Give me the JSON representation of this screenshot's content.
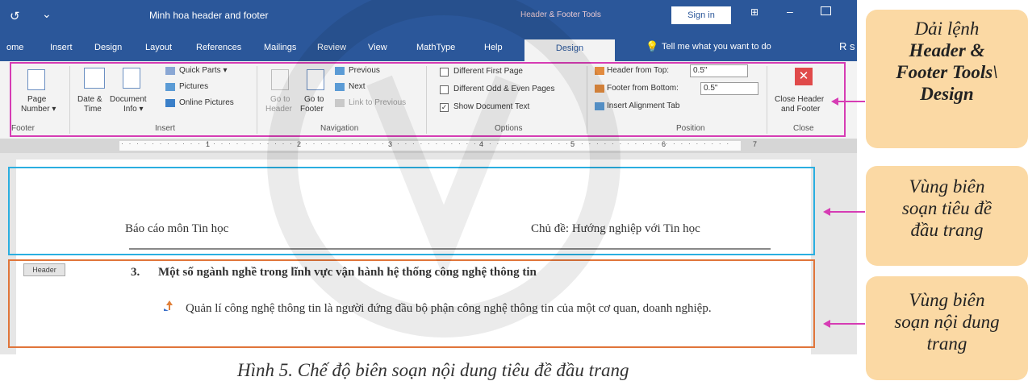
{
  "titlebar": {
    "qat_icon": "↺",
    "qat_more": "⌄",
    "document_title": "Minh hoa header and footer",
    "context_title": "Header & Footer Tools",
    "signin_label": "Sign in",
    "ribbon_display_icon": "ribbon-display-icon",
    "minimize_icon": "–",
    "maximize_icon": "maximize-icon"
  },
  "tabs": [
    {
      "label": "ome"
    },
    {
      "label": "Insert"
    },
    {
      "label": "Design"
    },
    {
      "label": "Layout"
    },
    {
      "label": "References"
    },
    {
      "label": "Mailings"
    },
    {
      "label": "Review"
    },
    {
      "label": "View"
    },
    {
      "label": "MathType"
    },
    {
      "label": "Help"
    },
    {
      "label": "Design"
    }
  ],
  "tellme": {
    "icon": "💡",
    "label": "Tell me what you want to do",
    "share_icon": "R s"
  },
  "ribbon": {
    "footer_group": {
      "page_number_1": "Page",
      "page_number_2": "Number ▾",
      "label": "Footer"
    },
    "insert_group": {
      "date_time_1": "Date &",
      "date_time_2": "Time",
      "doc_info_1": "Document",
      "doc_info_2": "Info ▾",
      "quick_parts": "Quick Parts ▾",
      "pictures": "Pictures",
      "online_pictures": "Online Pictures",
      "label": "Insert"
    },
    "navigation_group": {
      "goto_header_1": "Go to",
      "goto_header_2": "Header",
      "goto_footer_1": "Go to",
      "goto_footer_2": "Footer",
      "previous": "Previous",
      "next": "Next",
      "link_previous": "Link to Previous",
      "label": "Navigation"
    },
    "options_group": {
      "different_first": "Different First Page",
      "different_odd_even": "Different Odd & Even Pages",
      "show_doc_text": "Show Document Text",
      "show_doc_text_checked": true,
      "label": "Options"
    },
    "position_group": {
      "header_from_top": "Header from Top:",
      "header_value": "0.5\"",
      "footer_from_bottom": "Footer from Bottom:",
      "footer_value": "0.5\"",
      "insert_alignment_tab": "Insert Alignment Tab",
      "label": "Position"
    },
    "close_group": {
      "close_1": "Close Header",
      "close_2": "and Footer",
      "label": "Close"
    }
  },
  "ruler": {
    "numbers": [
      "1",
      "2",
      "3",
      "4",
      "5",
      "6",
      "7"
    ]
  },
  "document": {
    "header_left": "Báo cáo môn Tin học",
    "header_right": "Chủ đề: Hướng nghiệp với Tin học",
    "header_tag": "Header",
    "section_number": "3.",
    "section_title": "Một số ngành nghề trong lĩnh vực vận hành hệ thống công nghệ thông tin",
    "bullet_text": "Quản lí công nghệ thông tin là người đứng đầu bộ phận công nghệ thông tin của một cơ quan, doanh nghiệp."
  },
  "callouts": {
    "ribbon": {
      "line1": "Dải lệnh",
      "line2": "Header &",
      "line3": "Footer Tools\\",
      "line4": "Design"
    },
    "header_area": {
      "line1": "Vùng biên",
      "line2": "soạn tiêu đề",
      "line3": "đầu trang"
    },
    "content_area": {
      "line1": "Vùng biên",
      "line2": "soạn nội dung",
      "line3": "trang"
    }
  },
  "caption": "Hình 5. Chế độ biên soạn nội dung tiêu đề đầu trang",
  "colors": {
    "title_bar": "#2b579a",
    "ribbon_outline": "#d63cb4",
    "header_zone": "#2aaee0",
    "content_zone": "#e0753a",
    "callout_bg": "#fbd9a4"
  }
}
